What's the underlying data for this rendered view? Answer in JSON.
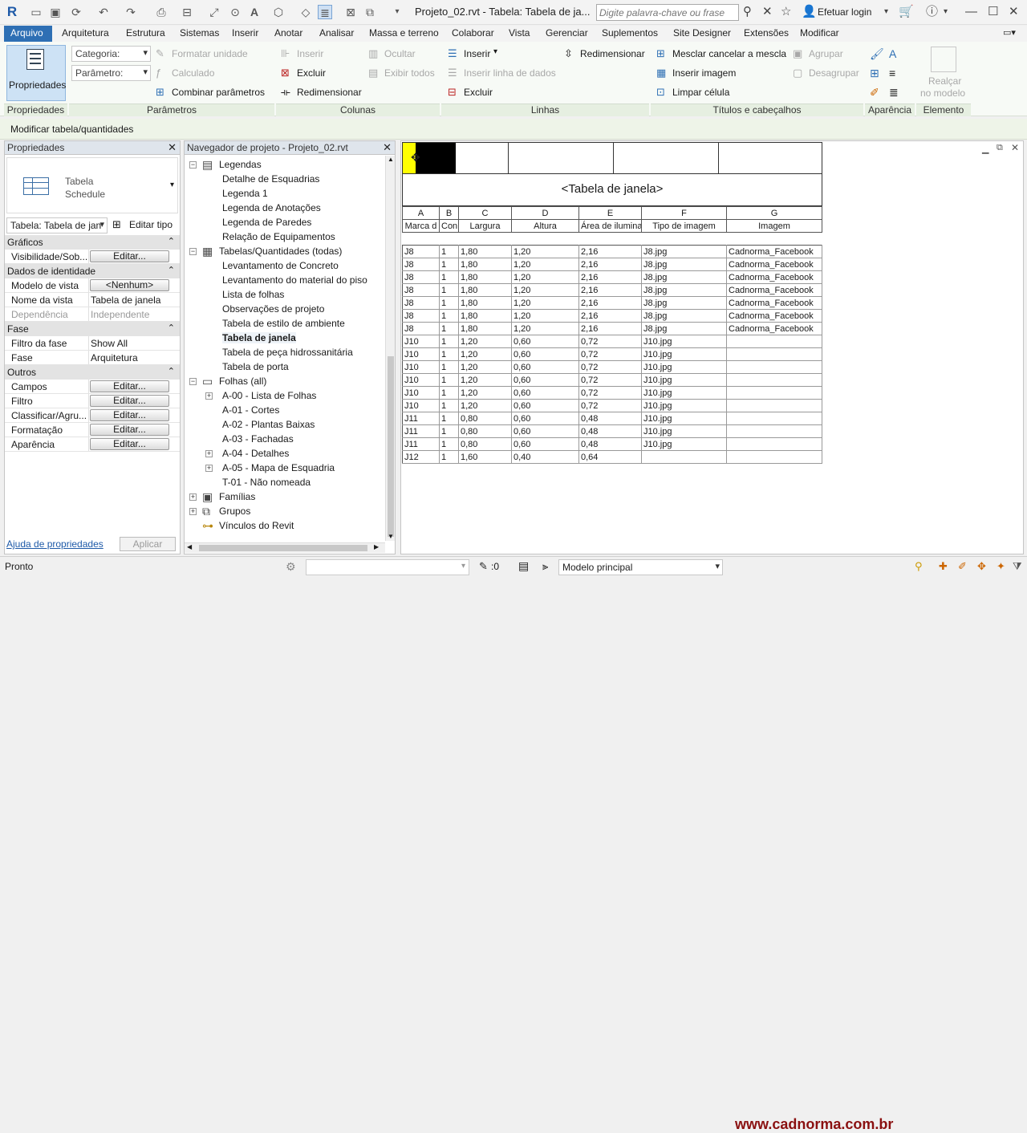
{
  "app": {
    "doc_title": "Projeto_02.rvt - Tabela: Tabela de ja...",
    "search_placeholder": "Digite palavra-chave ou frase",
    "login": "Efetuar login"
  },
  "tabs": [
    "Arquivo",
    "Arquitetura",
    "Estrutura",
    "Sistemas",
    "Inserir",
    "Anotar",
    "Analisar",
    "Massa e terreno",
    "Colaborar",
    "Vista",
    "Gerenciar",
    "Suplementos",
    "Site Designer",
    "Extensões",
    "Modificar"
  ],
  "ribbon": {
    "propriedades": "Propriedades",
    "categoria": "Categoria:",
    "parametro": "Parâmetro:",
    "formatar_unidade": "Formatar unidade",
    "calculado": "Calculado",
    "combinar": "Combinar parâmetros",
    "col_inserir": "Inserir",
    "col_excluir": "Excluir",
    "col_redimensionar": "Redimensionar",
    "ocultar": "Ocultar",
    "exibir_todos": "Exibir todos",
    "lin_inserir": "Inserir",
    "lin_inserir_dados": "Inserir linha de dados",
    "lin_excluir": "Excluir",
    "lin_redimensionar": "Redimensionar",
    "mesclar": "Mesclar cancelar a mescla",
    "inserir_imagem": "Inserir imagem",
    "limpar_celula": "Limpar célula",
    "agrupar": "Agrupar",
    "desagrupar": "Desagrupar",
    "realcar": "Realçar",
    "no_modelo": "no modelo",
    "panels": [
      "Propriedades",
      "Parâmetros",
      "Colunas",
      "Linhas",
      "Títulos e cabeçalhos",
      "Aparência",
      "Elemento"
    ]
  },
  "context_label": "Modificar tabela/quantidades",
  "properties": {
    "title": "Propriedades",
    "type_line1": "Tabela",
    "type_line2": "Schedule",
    "selector": "Tabela: Tabela de jan",
    "edit_type": "Editar tipo",
    "sections": [
      {
        "name": "Gráficos",
        "rows": [
          {
            "k": "Visibilidade/Sob...",
            "btn": "Editar..."
          }
        ]
      },
      {
        "name": "Dados de identidade",
        "rows": [
          {
            "k": "Modelo de vista",
            "btn": "<Nenhum>"
          },
          {
            "k": "Nome da vista",
            "v": "Tabela de janela"
          },
          {
            "k": "Dependência",
            "v": "Independente",
            "dis": true
          }
        ]
      },
      {
        "name": "Fase",
        "rows": [
          {
            "k": "Filtro da fase",
            "v": "Show All"
          },
          {
            "k": "Fase",
            "v": "Arquitetura"
          }
        ]
      },
      {
        "name": "Outros",
        "rows": [
          {
            "k": "Campos",
            "btn": "Editar..."
          },
          {
            "k": "Filtro",
            "btn": "Editar..."
          },
          {
            "k": "Classificar/Agru...",
            "btn": "Editar..."
          },
          {
            "k": "Formatação",
            "btn": "Editar..."
          },
          {
            "k": "Aparência",
            "btn": "Editar..."
          }
        ]
      }
    ],
    "help_link": "Ajuda de propriedades",
    "apply": "Aplicar"
  },
  "navigator": {
    "title": "Navegador de projeto - Projeto_02.rvt",
    "items": [
      {
        "label": "Legendas",
        "level": 0,
        "exp": "-",
        "icon": "legend"
      },
      {
        "label": "Detalhe de Esquadrias",
        "level": 1
      },
      {
        "label": "Legenda 1",
        "level": 1
      },
      {
        "label": "Legenda de Anotações",
        "level": 1
      },
      {
        "label": "Legenda de Paredes",
        "level": 1
      },
      {
        "label": "Relação de Equipamentos",
        "level": 1
      },
      {
        "label": "Tabelas/Quantidades (todas)",
        "level": 0,
        "exp": "-",
        "icon": "table"
      },
      {
        "label": "Levantamento de Concreto",
        "level": 1
      },
      {
        "label": "Levantamento do material do piso",
        "level": 1
      },
      {
        "label": "Lista de folhas",
        "level": 1
      },
      {
        "label": "Observações de projeto",
        "level": 1
      },
      {
        "label": "Tabela de estilo de ambiente",
        "level": 1
      },
      {
        "label": "Tabela de janela",
        "level": 1,
        "bold": true
      },
      {
        "label": "Tabela de peça hidrossanitária",
        "level": 1
      },
      {
        "label": "Tabela de porta",
        "level": 1
      },
      {
        "label": "Folhas (all)",
        "level": 0,
        "exp": "-",
        "icon": "sheet"
      },
      {
        "label": "A-00 - Lista de Folhas",
        "level": 1,
        "exp": "+"
      },
      {
        "label": "A-01 - Cortes",
        "level": 1
      },
      {
        "label": "A-02 - Plantas Baixas",
        "level": 1
      },
      {
        "label": "A-03 - Fachadas",
        "level": 1
      },
      {
        "label": "A-04 - Detalhes",
        "level": 1,
        "exp": "+"
      },
      {
        "label": "A-05 - Mapa de Esquadria",
        "level": 1,
        "exp": "+"
      },
      {
        "label": "T-01 - Não nomeada",
        "level": 1
      },
      {
        "label": "Famílias",
        "level": 0,
        "exp": "+",
        "icon": "family"
      },
      {
        "label": "Grupos",
        "level": 0,
        "exp": "+",
        "icon": "group"
      },
      {
        "label": "Vínculos do Revit",
        "level": 0,
        "icon": "link"
      }
    ]
  },
  "schedule": {
    "title": "<Tabela de janela>",
    "letters": [
      "A",
      "B",
      "C",
      "D",
      "E",
      "F",
      "G"
    ],
    "headers": [
      "Marca d",
      "Con",
      "Largura",
      "Altura",
      "Área de ilumina",
      "Tipo de imagem",
      "Imagem"
    ],
    "rows": [
      [
        "J8",
        "1",
        "1,80",
        "1,20",
        "2,16",
        "J8.jpg",
        "Cadnorma_Facebook"
      ],
      [
        "J8",
        "1",
        "1,80",
        "1,20",
        "2,16",
        "J8.jpg",
        "Cadnorma_Facebook"
      ],
      [
        "J8",
        "1",
        "1,80",
        "1,20",
        "2,16",
        "J8.jpg",
        "Cadnorma_Facebook"
      ],
      [
        "J8",
        "1",
        "1,80",
        "1,20",
        "2,16",
        "J8.jpg",
        "Cadnorma_Facebook"
      ],
      [
        "J8",
        "1",
        "1,80",
        "1,20",
        "2,16",
        "J8.jpg",
        "Cadnorma_Facebook"
      ],
      [
        "J8",
        "1",
        "1,80",
        "1,20",
        "2,16",
        "J8.jpg",
        "Cadnorma_Facebook"
      ],
      [
        "J8",
        "1",
        "1,80",
        "1,20",
        "2,16",
        "J8.jpg",
        "Cadnorma_Facebook"
      ],
      [
        "J10",
        "1",
        "1,20",
        "0,60",
        "0,72",
        "J10.jpg",
        ""
      ],
      [
        "J10",
        "1",
        "1,20",
        "0,60",
        "0,72",
        "J10.jpg",
        ""
      ],
      [
        "J10",
        "1",
        "1,20",
        "0,60",
        "0,72",
        "J10.jpg",
        ""
      ],
      [
        "J10",
        "1",
        "1,20",
        "0,60",
        "0,72",
        "J10.jpg",
        ""
      ],
      [
        "J10",
        "1",
        "1,20",
        "0,60",
        "0,72",
        "J10.jpg",
        ""
      ],
      [
        "J10",
        "1",
        "1,20",
        "0,60",
        "0,72",
        "J10.jpg",
        ""
      ],
      [
        "J11",
        "1",
        "0,80",
        "0,60",
        "0,48",
        "J10.jpg",
        ""
      ],
      [
        "J11",
        "1",
        "0,80",
        "0,60",
        "0,48",
        "J10.jpg",
        ""
      ],
      [
        "J11",
        "1",
        "0,80",
        "0,60",
        "0,48",
        "J10.jpg",
        ""
      ],
      [
        "J12",
        "1",
        "1,60",
        "0,40",
        "0,64",
        "",
        ""
      ]
    ]
  },
  "status": {
    "text": "Pronto",
    "zero": ":0",
    "model": "Modelo principal",
    "website": "www.cadnorma.com.br"
  },
  "colors": {
    "accent": "#2e6fb4",
    "highlight": "#ffff00",
    "brand": "#8a1010"
  }
}
